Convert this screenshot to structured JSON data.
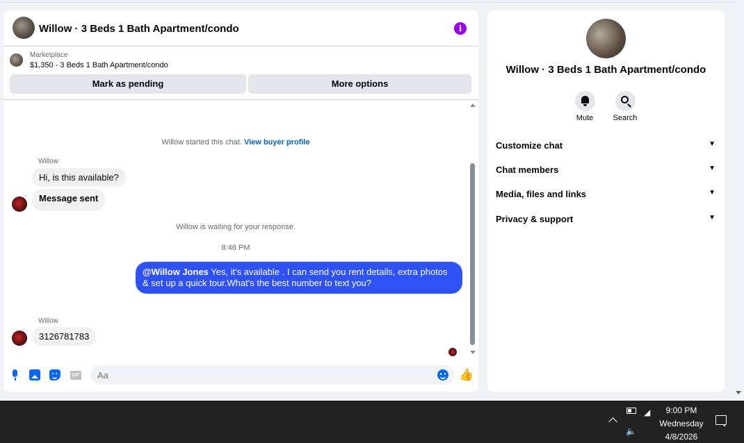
{
  "chat": {
    "title": "Willow · 3 Beds 1 Bath Apartment/condo",
    "marketplace_label": "Marketplace",
    "listing": "$1,350 - 3 Beds 1 Bath Apartment/condo",
    "mark_pending": "Mark as pending",
    "more_options": "More options",
    "started_text": "Willow started this chat.",
    "view_profile": "View buyer profile",
    "sender_name": "Willow",
    "msg_available": "Hi, is this available?",
    "msg_sent": "Message sent",
    "waiting_text": "Willow is waiting for your response.",
    "timestamp": "8:46 PM",
    "out_mention": "@Willow Jones",
    "out_text": " Yes, it's available .  I can send you rent details, extra photos & set up a quick tour.What's the best number to text you?",
    "sender_name_2": "Willow",
    "msg_phone": "3126781783",
    "input_placeholder": "Aa",
    "gif_label": "GIF"
  },
  "panel": {
    "title": "Willow · 3 Beds 1 Bath Apartment/condo",
    "mute_label": "Mute",
    "search_label": "Search",
    "sections": [
      "Customize chat",
      "Chat members",
      "Media, files and links",
      "Privacy & support"
    ]
  },
  "taskbar": {
    "time": "9:00 PM",
    "day": "Wednesday",
    "date": "4/8/2026"
  },
  "colors": {
    "accent": "#0866ff",
    "outgoing_bubble": "#2f52f6",
    "info": "#9b00e8"
  }
}
